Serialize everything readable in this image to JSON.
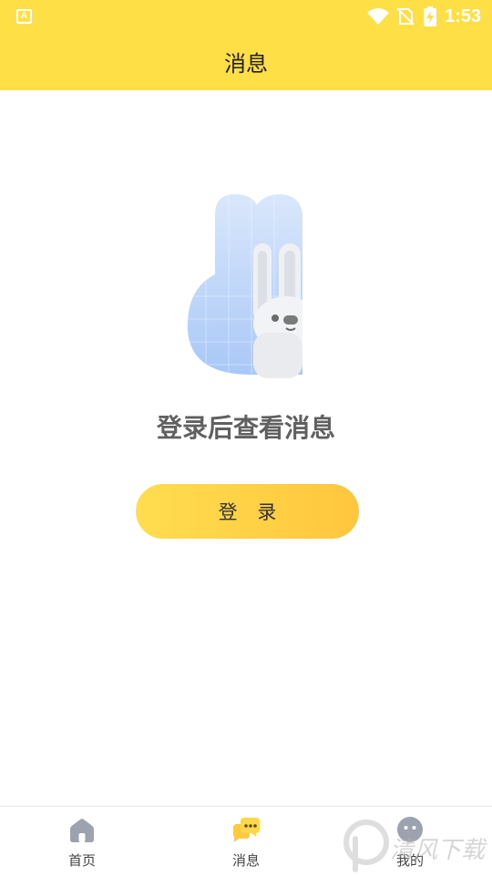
{
  "status_bar": {
    "app_badge": "A",
    "time": "1:53",
    "icons": [
      "wifi-icon",
      "no-sim-icon",
      "battery-charging-icon"
    ]
  },
  "header": {
    "title": "消息"
  },
  "empty_state": {
    "illustration": "rabbit-peek-illustration",
    "message": "登录后查看消息",
    "login_button": "登 录"
  },
  "tab_bar": {
    "tabs": [
      {
        "label": "首页",
        "icon": "home-icon",
        "active": false
      },
      {
        "label": "消息",
        "icon": "message-icon",
        "active": true
      },
      {
        "label": "我的",
        "icon": "profile-icon",
        "active": false
      }
    ]
  },
  "watermark": {
    "text": "清风下载",
    "icon": "watermark-logo-icon"
  },
  "colors": {
    "accent_yellow": "#FFDE46",
    "button_gradient_start": "#FFDD4F",
    "button_gradient_end": "#FFC63D",
    "inactive_icon": "#9CA3AF"
  }
}
